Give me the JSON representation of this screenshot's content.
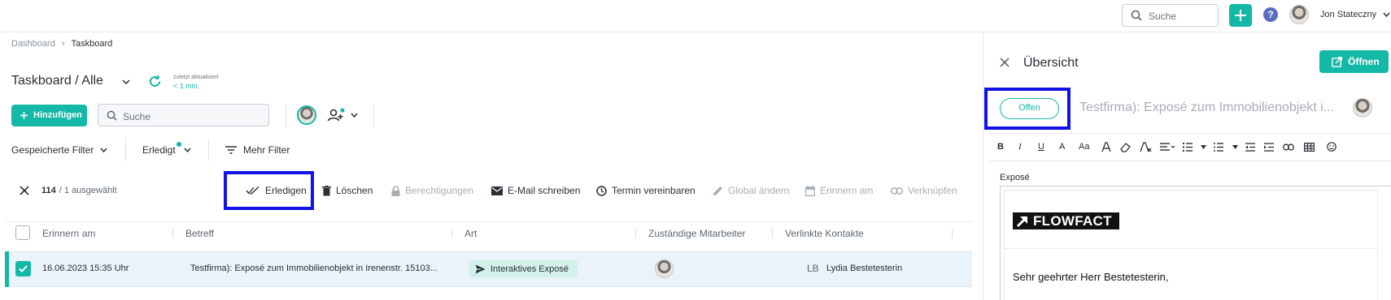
{
  "topbar": {
    "search_placeholder": "Suche",
    "user_name": "Jon Stateczny",
    "icons": [
      "search-icon",
      "plus-icon",
      "help-icon",
      "avatar",
      "chevron-down-icon"
    ]
  },
  "breadcrumb": {
    "items": [
      "Dashboard",
      "Taskboard"
    ]
  },
  "header": {
    "title": "Taskboard / Alle",
    "updated_label": "zuletzt aktualisiert",
    "updated_value": "< 1 min."
  },
  "toolbar": {
    "add_label": "Hinzufügen",
    "search_placeholder": "Suche"
  },
  "filters": {
    "saved": "Gespeicherte Filter",
    "done": "Erledigt",
    "more": "Mehr Filter"
  },
  "selection": {
    "count": "114",
    "suffix": "/ 1 ausgewählt"
  },
  "actions": [
    {
      "label": "Erledigen",
      "enabled": true
    },
    {
      "label": "Löschen",
      "enabled": true
    },
    {
      "label": "Berechtigungen",
      "enabled": false
    },
    {
      "label": "E-Mail schreiben",
      "enabled": true
    },
    {
      "label": "Termin vereinbaren",
      "enabled": true
    },
    {
      "label": "Global ändern",
      "enabled": false
    },
    {
      "label": "Erinnern am",
      "enabled": false
    },
    {
      "label": "Verknüpfen",
      "enabled": false
    }
  ],
  "table": {
    "columns": [
      "Erinnern am",
      "Betreff",
      "Art",
      "Zuständige Mitarbeiter",
      "Verlinkte Kontakte"
    ],
    "rows": [
      {
        "remind": "16.06.2023 15:35 Uhr",
        "subject": "Testfirma): Exposé zum Immobilienobjekt in Irenenstr. 15103...",
        "type": "Interaktives Exposé",
        "contact_initials": "LB",
        "contact_name": "Lydia Bestetesterin"
      }
    ]
  },
  "panel": {
    "title": "Übersicht",
    "open_label": "Öffnen",
    "status": "Offen",
    "subject": "Testfirma): Exposé zum Immobilienobjekt i...",
    "field_label": "Exposé",
    "logo_text": "FLOWFACT",
    "greeting": "Sehr geehrter Herr Bestetesterin,",
    "editor_tools": [
      "B",
      "I",
      "U",
      "A",
      "Aa"
    ]
  },
  "colors": {
    "accent": "#14b8a6",
    "highlight": "#1212e6",
    "row_selected": "#eaf3f9"
  }
}
